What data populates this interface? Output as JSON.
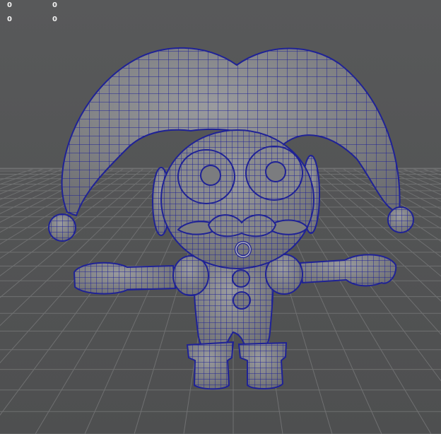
{
  "viewport": {
    "hud_rows": [
      {
        "left": "0",
        "right": "0"
      },
      {
        "left": "0",
        "right": "0"
      }
    ],
    "model_label": "",
    "colors": {
      "background": "#555657",
      "grid": "#6f7071",
      "mesh_fill": "#8d8e91",
      "wireframe": "#1f2296"
    }
  }
}
